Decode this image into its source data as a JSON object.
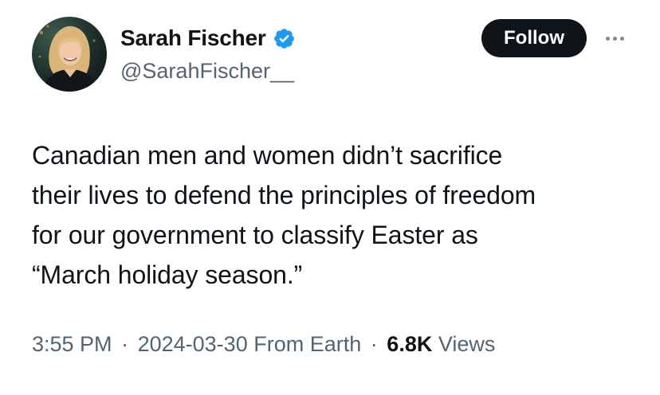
{
  "author": {
    "display_name": "Sarah Fischer",
    "handle": "@SarahFischer__",
    "verified": true,
    "avatar_icon": "profile-photo-avatar"
  },
  "actions": {
    "follow_label": "Follow",
    "more_icon": "more-options-icon"
  },
  "tweet": {
    "lines": [
      "Canadian men and women didn’t sacrifice",
      "their lives to defend the principles of freedom",
      "for our government to classify Easter as",
      "“March holiday season.”"
    ]
  },
  "meta": {
    "time": "3:55 PM",
    "separator": "·",
    "date": "2024-03-30",
    "location": "From Earth",
    "views_count": "6.8K",
    "views_label": "Views"
  },
  "colors": {
    "text_primary": "#0f1419",
    "text_secondary": "#536471",
    "verified_blue": "#1d9bf0",
    "follow_bg": "#0f1419",
    "background": "#ffffff"
  }
}
